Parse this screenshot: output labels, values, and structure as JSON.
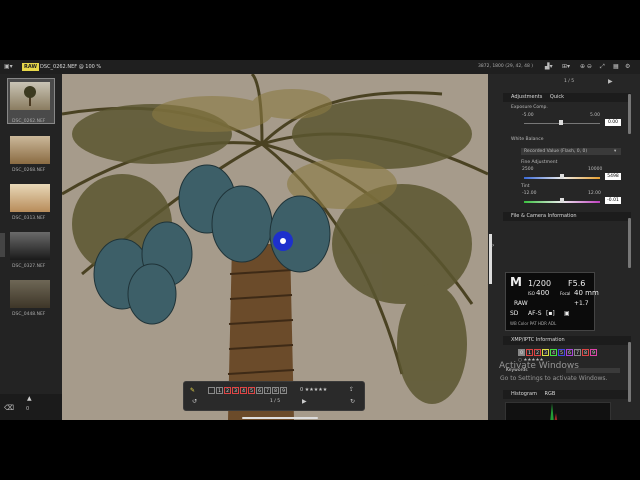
{
  "toolbar": {
    "raw_badge": "RAW",
    "file_title": "DSC_0262.NEF @ 100 %",
    "coords": "3872, 1800 (29, 42, 48 )",
    "img_icon": "image-icon",
    "zoom_icon": "zoom-icon"
  },
  "filmstrip": [
    {
      "label": "DSC_0262.NEF"
    },
    {
      "label": "DSC_0268.NEF"
    },
    {
      "label": "DSC_0313.NEF"
    },
    {
      "label": "DSC_0327.NEF"
    },
    {
      "label": "DSC_0448.NEF"
    }
  ],
  "filmstrip_footer": {
    "count": "0"
  },
  "viewer_bar": {
    "labels": [
      "1",
      "2",
      "3",
      "4",
      "5",
      "6",
      "7",
      "8",
      "9"
    ],
    "stars": "0 ★★★★★",
    "page": "1 / 5"
  },
  "panel": {
    "page": "1 / 5",
    "adjustments": {
      "title": "Adjustments",
      "mode": "Quick",
      "exposure_label": "Exposure Comp.",
      "exp_min": "-5.00",
      "exp_max": "5.00",
      "exp_value": "0.00",
      "exposure_level": 0.0,
      "wb_label": "White Balance",
      "wb_select": "Recorded Value (Flash, 0, 0)",
      "fine_label": "Fine Adjustment",
      "fine_min": "2500",
      "fine_max": "10000",
      "fine_value": "5498",
      "tint_label": "Tint",
      "tint_min": "-12.00",
      "tint_max": "12.00",
      "tint_value": "-0.01"
    },
    "file_info": {
      "title": "File & Camera Information",
      "mode": "M",
      "shutter": "1/200",
      "aperture": "F5.6",
      "iso_label": "ISO",
      "iso": "400",
      "focal_label": "Focal",
      "focal": "40 mm",
      "raw": "RAW",
      "comp": "+1.7",
      "sd": "SD",
      "af": "AF-S"
    },
    "xmp": {
      "title": "XMP/IPTC Information",
      "labels": [
        "0",
        "1",
        "2",
        "3",
        "4",
        "5",
        "6",
        "7",
        "8",
        "9"
      ],
      "keywords_label": "Keywords"
    },
    "histogram": {
      "title": "Histogram",
      "channel": "RGB"
    }
  },
  "watermark": {
    "title": "Activate Windows",
    "subtitle": "Go to Settings to activate Windows."
  }
}
